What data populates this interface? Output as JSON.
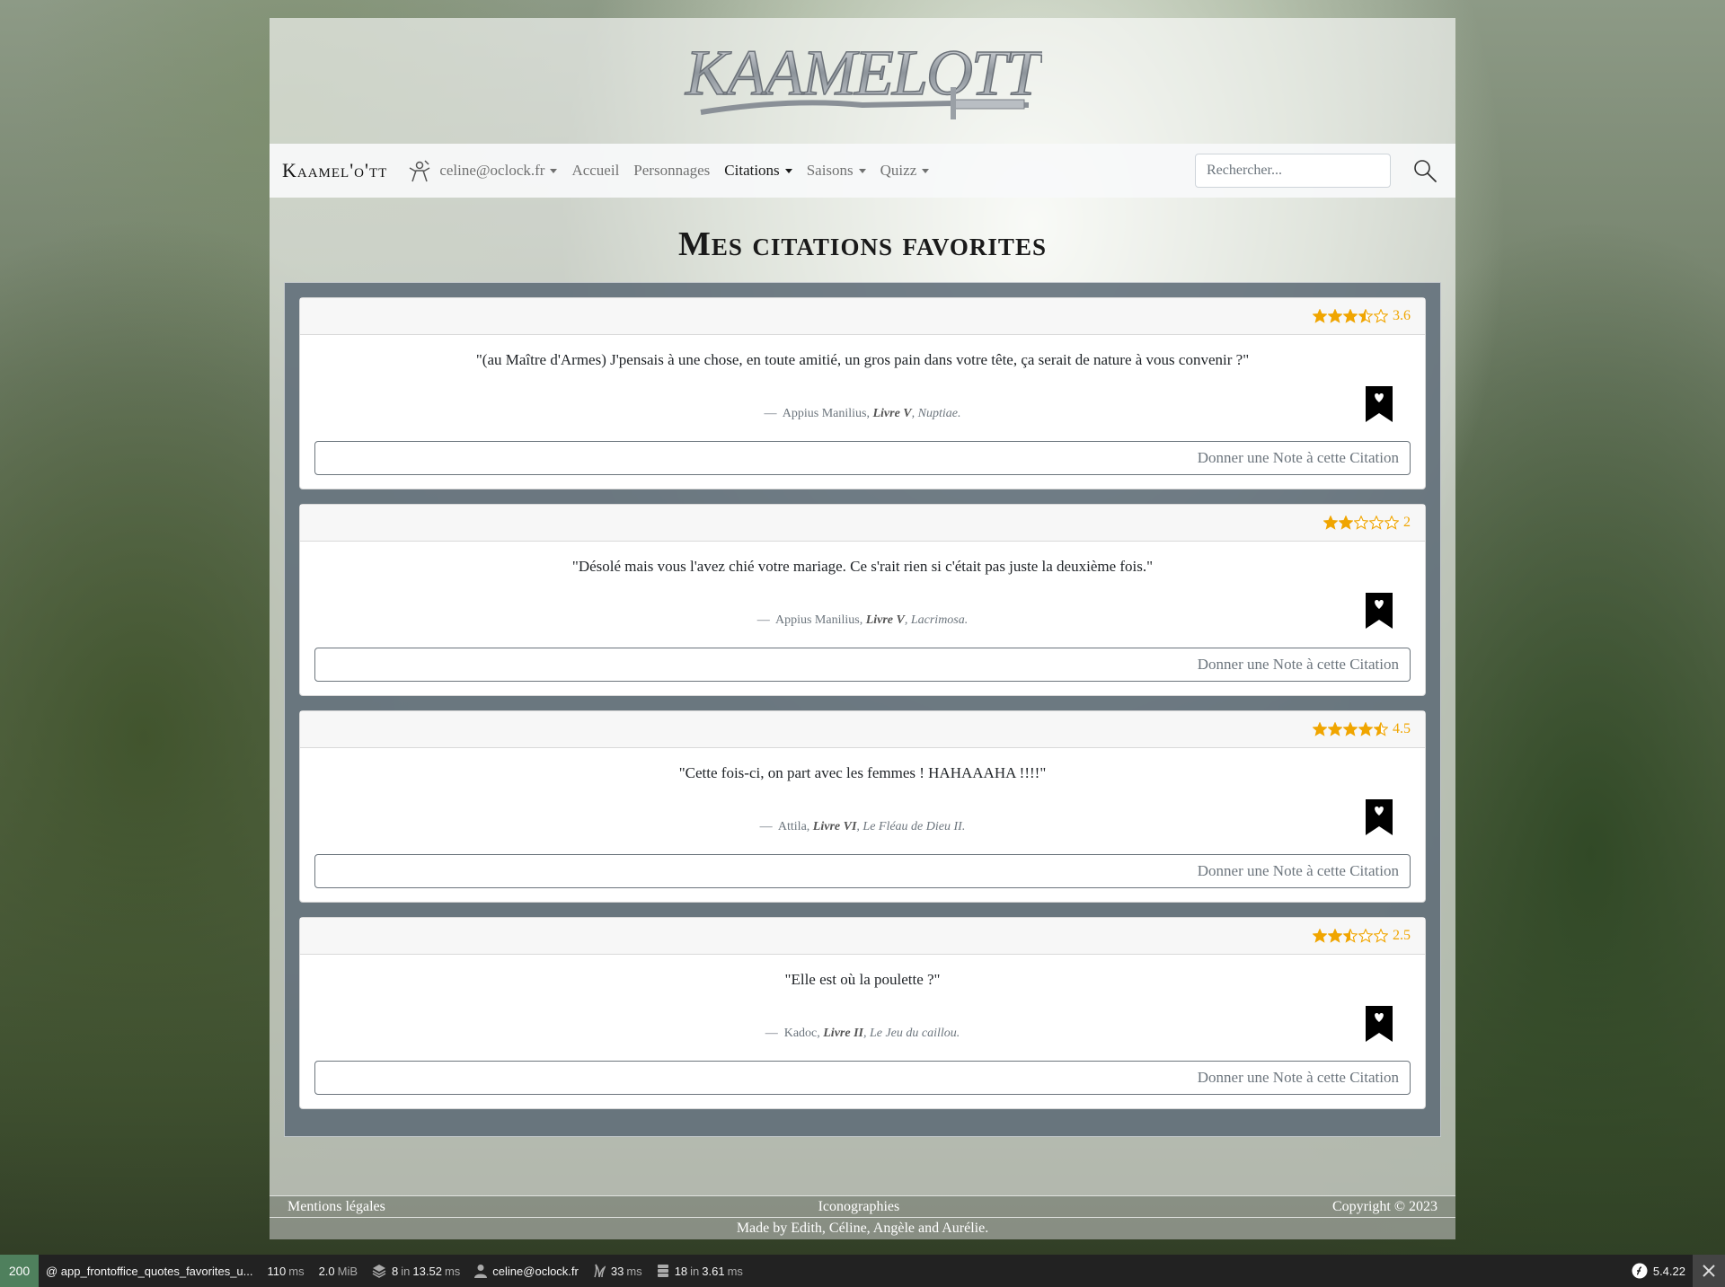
{
  "site": {
    "logo_text": "KAAMELOTT",
    "brand": "Kaamel'o'tt",
    "user_email": "celine@oclock.fr"
  },
  "nav": {
    "home": "Accueil",
    "characters": "Personnages",
    "quotes": "Citations",
    "seasons": "Saisons",
    "quiz": "Quizz"
  },
  "search": {
    "placeholder": "Rechercher..."
  },
  "page": {
    "title": "Mes citations favorites"
  },
  "rate_label": "Donner une Note à cette Citation",
  "quotes": [
    {
      "rating": "3.6",
      "rating_value": 3.6,
      "text": "\"(au Maître d'Armes) J'pensais à une chose, en toute amitié, un gros pain dans votre tête, ça serait de nature à vous convenir ?\"",
      "dash": "—",
      "author": "Appius Manilius,",
      "book": "Livre V",
      "episode": ", Nuptiae."
    },
    {
      "rating": "2",
      "rating_value": 2,
      "text": "\"Désolé mais vous l'avez chié votre mariage. Ce s'rait rien si c'était pas juste la deuxième fois.\"",
      "dash": "—",
      "author": "Appius Manilius,",
      "book": "Livre V",
      "episode": ", Lacrimosa."
    },
    {
      "rating": "4.5",
      "rating_value": 4.5,
      "text": "\"Cette fois-ci, on part avec les femmes ! HAHAAAHA !!!!\"",
      "dash": "—",
      "author": "Attila,",
      "book": "Livre VI",
      "episode": ", Le Fléau de Dieu II."
    },
    {
      "rating": "2.5",
      "rating_value": 2.5,
      "text": "\"Elle est où la poulette ?\"",
      "dash": "—",
      "author": "Kadoc,",
      "book": "Livre II",
      "episode": ", Le Jeu du caillou."
    }
  ],
  "footer": {
    "legal": "Mentions légales",
    "icons": "Iconographies",
    "copyright": "Copyright © 2023",
    "made_by": "Made by Edith, Céline, Angèle and Aurélie."
  },
  "debug": {
    "status": "200",
    "route": "@ app_frontoffice_quotes_favorites_u...",
    "time": "110",
    "time_unit": "ms",
    "memory": "2.0",
    "memory_unit": "MiB",
    "cache_count": "8",
    "cache_in": "in",
    "cache_time": "13.52",
    "cache_unit": "ms",
    "user": "celine@oclock.fr",
    "twig_time": "33",
    "twig_unit": "ms",
    "db_count": "18",
    "db_in": "in",
    "db_time": "3.61",
    "db_unit": "ms",
    "symfony_version": "5.4.22"
  },
  "colors": {
    "star": "#f0a500",
    "debug_status": "#4f805d"
  }
}
